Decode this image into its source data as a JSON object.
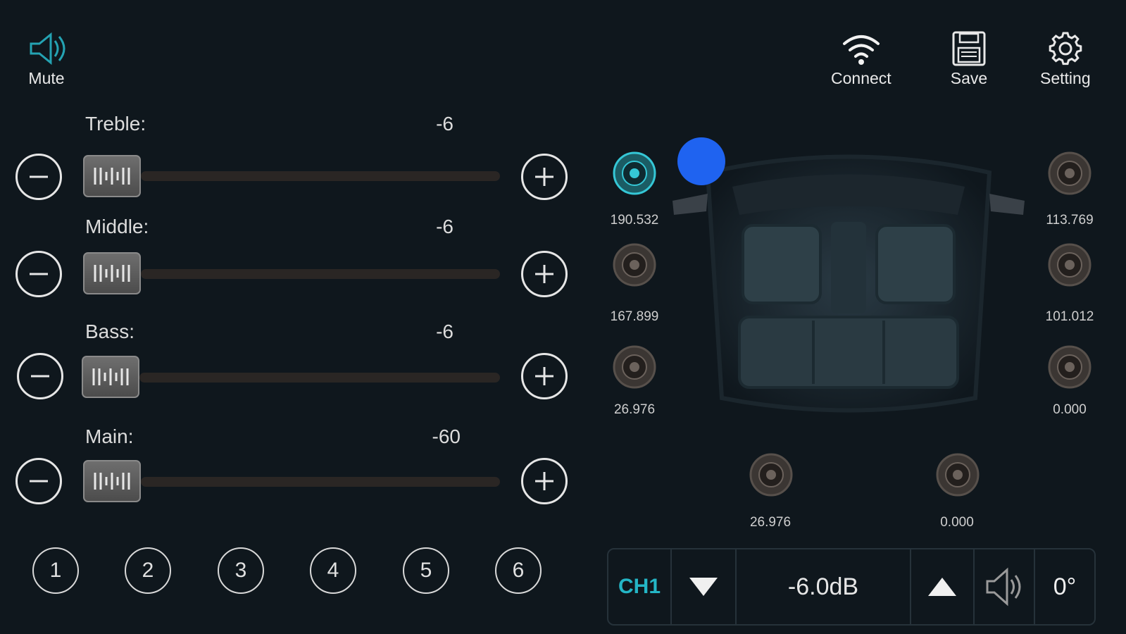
{
  "header": {
    "mute_label": "Mute",
    "connect_label": "Connect",
    "save_label": "Save",
    "setting_label": "Setting"
  },
  "sliders": [
    {
      "label": "Treble:",
      "value": "-6"
    },
    {
      "label": "Middle:",
      "value": "-6"
    },
    {
      "label": "Bass:",
      "value": "-6"
    },
    {
      "label": "Main:",
      "value": "-60"
    }
  ],
  "presets": [
    "1",
    "2",
    "3",
    "4",
    "5",
    "6"
  ],
  "speakers": {
    "front_left": "190.532",
    "mid_left": "167.899",
    "rear_left": "26.976",
    "front_right": "113.769",
    "mid_right": "101.012",
    "rear_right": "0.000",
    "bottom_left": "26.976",
    "bottom_right": "0.000"
  },
  "control_bar": {
    "channel": "CH1",
    "level": "-6.0dB",
    "phase": "0°"
  },
  "colors": {
    "background": "#0f171d",
    "accent": "#24b6c6",
    "indicator": "#1f63f0"
  }
}
